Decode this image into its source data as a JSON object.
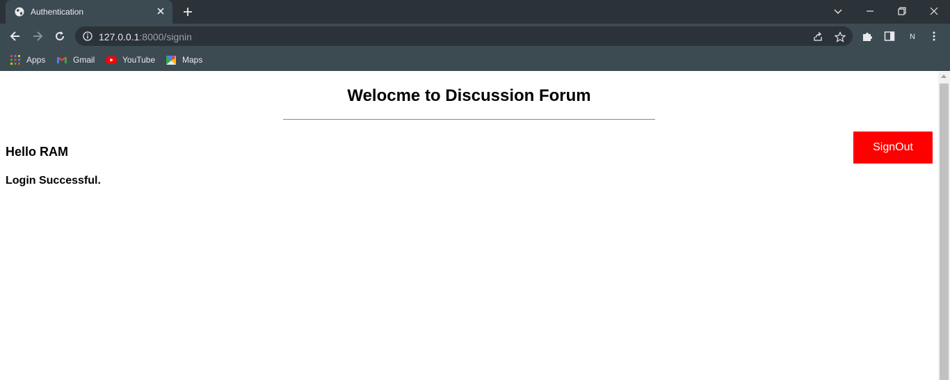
{
  "browser": {
    "tab": {
      "title": "Authentication"
    },
    "url": {
      "host": "127.0.0.1",
      "rest": ":8000/signin"
    },
    "profile_initial": "N",
    "bookmarks": [
      {
        "label": "Apps",
        "icon": "apps-grid-icon"
      },
      {
        "label": "Gmail",
        "icon": "gmail-icon"
      },
      {
        "label": "YouTube",
        "icon": "youtube-icon"
      },
      {
        "label": "Maps",
        "icon": "maps-icon"
      }
    ]
  },
  "page": {
    "title": "Welocme to Discussion Forum",
    "greeting": "Hello RAM",
    "status": "Login Successful.",
    "signout_label": "SignOut"
  },
  "colors": {
    "signout_bg": "#ff0000",
    "chrome_dark": "#2b3338",
    "chrome_mid": "#3c4a52"
  }
}
